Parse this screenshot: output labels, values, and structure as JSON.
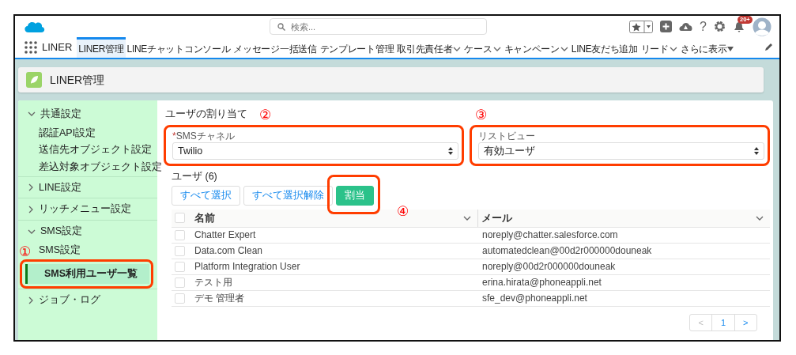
{
  "header": {
    "search_placeholder": "検索...",
    "help": "?",
    "notification_count": "20+"
  },
  "nav": {
    "app_name": "LINER",
    "tabs": [
      {
        "label": "LINER管理",
        "selected": true,
        "dropdown": false
      },
      {
        "label": "LINEチャットコンソール",
        "selected": false,
        "dropdown": false
      },
      {
        "label": "メッセージ一括送信",
        "selected": false,
        "dropdown": false
      },
      {
        "label": "テンプレート管理",
        "selected": false,
        "dropdown": false
      },
      {
        "label": "取引先責任者",
        "selected": false,
        "dropdown": true
      },
      {
        "label": "ケース",
        "selected": false,
        "dropdown": true
      },
      {
        "label": "キャンペーン",
        "selected": false,
        "dropdown": true
      },
      {
        "label": "LINE友だち追加",
        "selected": false,
        "dropdown": false
      },
      {
        "label": "リード",
        "selected": false,
        "dropdown": true
      }
    ],
    "more": "さらに表示"
  },
  "page_title": "LINER管理",
  "sidebar": {
    "sections": [
      {
        "label": "共通設定",
        "expanded": true,
        "children": [
          {
            "label": "認証API設定",
            "selected": false
          },
          {
            "label": "送信先オブジェクト設定",
            "selected": false
          },
          {
            "label": "差込対象オブジェクト設定",
            "selected": false
          }
        ]
      },
      {
        "label": "LINE設定",
        "expanded": false
      },
      {
        "label": "リッチメニュー設定",
        "expanded": false
      },
      {
        "label": "SMS設定",
        "expanded": true,
        "children": [
          {
            "label": "SMS設定",
            "selected": false
          },
          {
            "label": "SMS利用ユーザ一覧",
            "selected": true,
            "annotation": "①"
          }
        ]
      },
      {
        "label": "ジョブ・ログ",
        "expanded": false
      }
    ]
  },
  "content": {
    "heading": "ユーザの割り当て",
    "fields": [
      {
        "label": "SMSチャネル",
        "required": true,
        "required_mark": "*",
        "value": "Twilio",
        "annotation": "②"
      },
      {
        "label": "リストビュー",
        "value": "有効ユーザ",
        "annotation": "③"
      }
    ],
    "users_label": "ユーザ (6)",
    "buttons": [
      {
        "label": "すべて選択",
        "kind": "neutral"
      },
      {
        "label": "すべて選択解除",
        "kind": "neutral"
      },
      {
        "label": "割当",
        "kind": "success",
        "annotation": "④"
      }
    ],
    "table": {
      "select_all": false,
      "columns": [
        "名前",
        "メール"
      ],
      "rows": [
        {
          "selected": false,
          "name": "Chatter Expert",
          "email": "noreply@chatter.salesforce.com"
        },
        {
          "selected": false,
          "name": "Data.com Clean",
          "email": "automatedclean@00d2r000000douneak"
        },
        {
          "selected": false,
          "name": "Platform Integration User",
          "email": "noreply@00d2r000000douneak"
        },
        {
          "selected": false,
          "name": "テスト用",
          "email": "erina.hirata@phoneappli.net"
        },
        {
          "selected": false,
          "name": "デモ 管理者",
          "email": "sfe_dev@phoneappli.net"
        }
      ]
    },
    "pagination": {
      "prev": "<",
      "page": "1",
      "next": ">"
    }
  }
}
